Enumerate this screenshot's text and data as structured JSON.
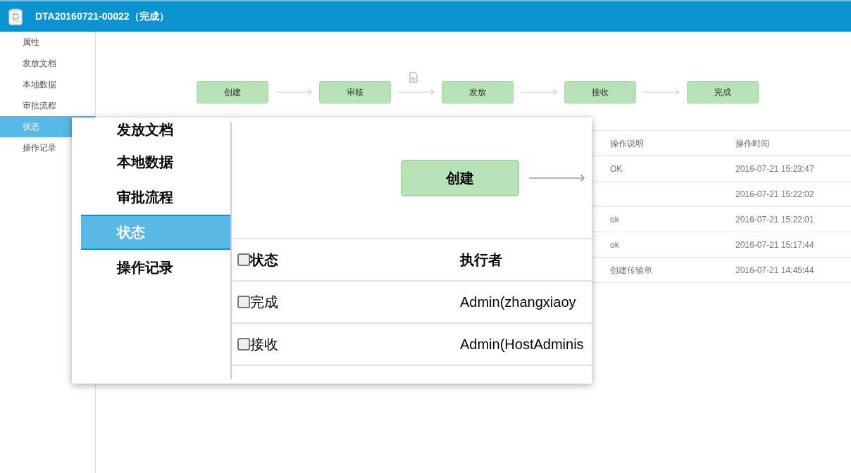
{
  "window": {
    "title": "DTA20160721-00022（完成）"
  },
  "sidebar": {
    "items": [
      {
        "label": "属性",
        "selected": false
      },
      {
        "label": "发放文档",
        "selected": false
      },
      {
        "label": "本地数据",
        "selected": false
      },
      {
        "label": "审批流程",
        "selected": false
      },
      {
        "label": "状态",
        "selected": true
      },
      {
        "label": "操作记录",
        "selected": false
      }
    ]
  },
  "flow": {
    "steps": [
      {
        "label": "创建"
      },
      {
        "label": "审核"
      },
      {
        "label": "发放"
      },
      {
        "label": "接收"
      },
      {
        "label": "完成"
      }
    ]
  },
  "log_table": {
    "columns": [
      "操作说明",
      "操作时间"
    ],
    "rows": [
      {
        "description": "OK",
        "time": "2016-07-21 15:23:47"
      },
      {
        "time": "2016-07-21 15:22:02"
      },
      {
        "description": "ok",
        "time": "2016-07-21 15:22:01"
      },
      {
        "description": "ok",
        "time": "2016-07-21 15:17:44"
      },
      {
        "description": "创建传输单",
        "time": "2016-07-21 14:45:44"
      }
    ]
  },
  "magnifier": {
    "nav_items": [
      {
        "label": "发放文档",
        "selected": false
      },
      {
        "label": "本地数据",
        "selected": false
      },
      {
        "label": "审批流程",
        "selected": false
      },
      {
        "label": "状态",
        "selected": true
      },
      {
        "label": "操作记录",
        "selected": false
      }
    ],
    "flow_step": "创建",
    "table": {
      "header": {
        "checked": false,
        "status": "状态",
        "executor": "执行者"
      },
      "rows": [
        {
          "checked": false,
          "status": "完成",
          "executor": "Admin(zhangxiaoy"
        },
        {
          "checked": false,
          "status": "接收",
          "executor": "Admin(HostAdminis"
        }
      ]
    }
  }
}
